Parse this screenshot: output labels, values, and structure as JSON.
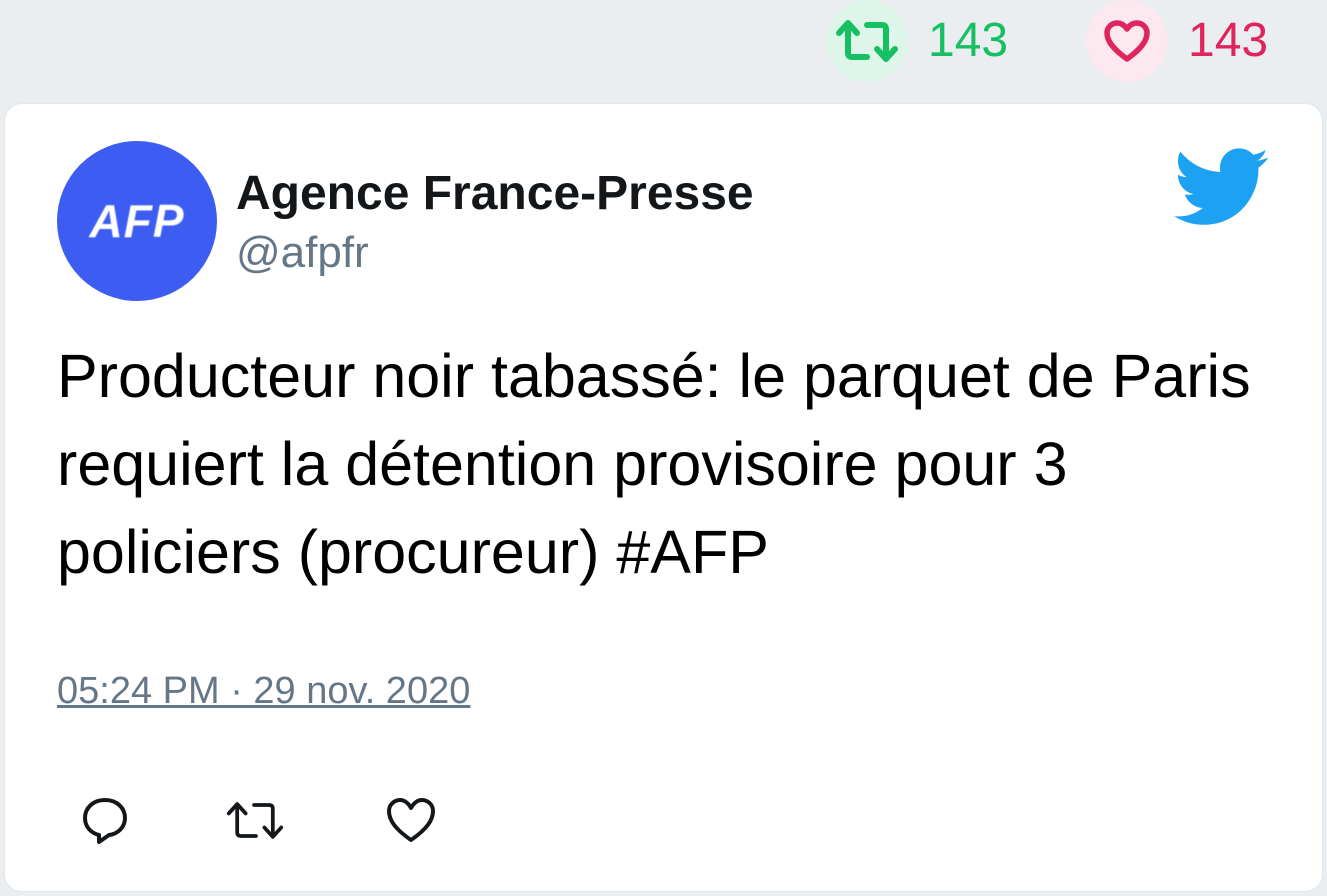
{
  "stats": {
    "retweet_count": "143",
    "like_count": "143",
    "retweet_icon": "retweet-icon",
    "like_icon": "heart-icon",
    "retweet_color": "#17bf63",
    "like_color": "#e0245e"
  },
  "tweet": {
    "author_name": "Agence France-Presse",
    "author_handle": "@afpfr",
    "avatar_text": "AFP",
    "avatar_color": "#3d5cf2",
    "text": "Producteur noir tabassé: le parquet de Paris requiert la détention provisoire pour 3 policiers (procureur) #AFP",
    "timestamp": "05:24 PM · 29 nov. 2020",
    "brand_icon": "twitter-bird-icon",
    "brand_color": "#1da1f2"
  },
  "actions": {
    "icons": [
      "reply-icon",
      "retweet-icon",
      "heart-icon"
    ]
  }
}
